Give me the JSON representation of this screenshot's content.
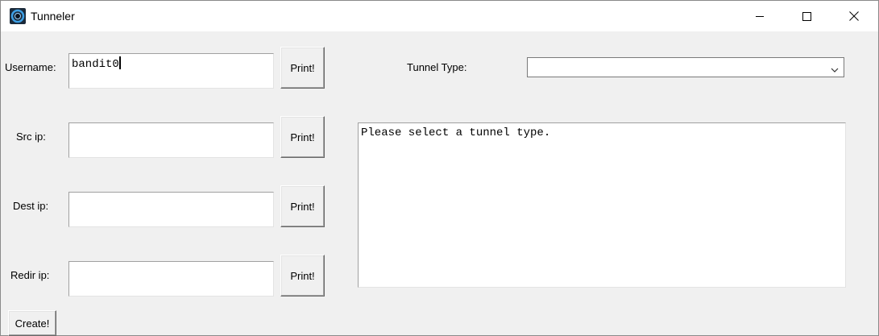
{
  "window": {
    "title": "Tunneler",
    "icon": "tunnel-app-icon",
    "controls": {
      "minimize_icon": "minimize-icon",
      "maximize_icon": "maximize-icon",
      "close_icon": "close-icon"
    }
  },
  "form": {
    "username": {
      "label": "Username:",
      "value": "bandit0",
      "button": "Print!"
    },
    "src_ip": {
      "label": "Src ip:",
      "value": "",
      "button": "Print!"
    },
    "dest_ip": {
      "label": "Dest ip:",
      "value": "",
      "button": "Print!"
    },
    "redir_ip": {
      "label": "Redir ip:",
      "value": "",
      "button": "Print!"
    },
    "create_button": "Create!"
  },
  "tunnel": {
    "label": "Tunnel Type:",
    "selected": "",
    "arrow_icon": "chevron-down-icon"
  },
  "output": {
    "text": "Please select a tunnel type."
  }
}
